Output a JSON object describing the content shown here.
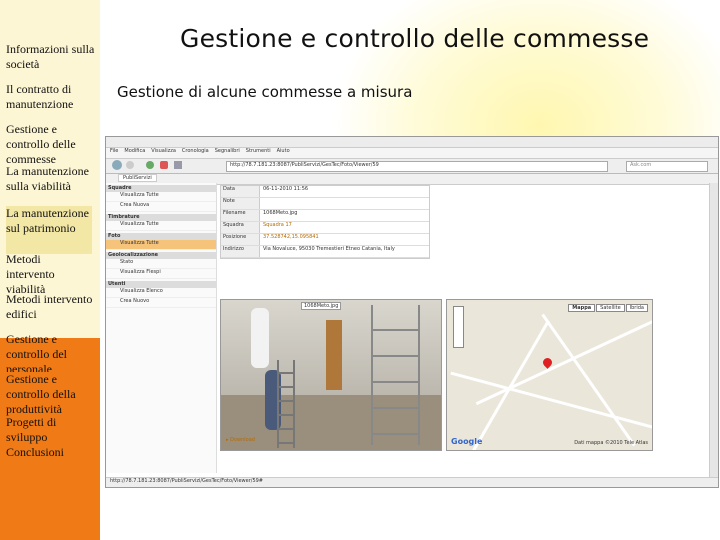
{
  "sidebar": {
    "items": [
      {
        "label": "Informazioni sulla società"
      },
      {
        "label": "Il contratto di manutenzione"
      },
      {
        "label": "Gestione e controllo delle commesse"
      },
      {
        "label": "La manutenzione sulla viabilità"
      },
      {
        "label": "La manutenzione sul patrimonio"
      },
      {
        "label": "Metodi intervento viabilità"
      },
      {
        "label": "Metodi intervento edifici"
      },
      {
        "label": "Gestione e controllo del personale"
      },
      {
        "label": "Gestione e controllo della produttività"
      },
      {
        "label": "Progetti di sviluppo"
      },
      {
        "label": "Conclusioni"
      }
    ]
  },
  "slide": {
    "title": "Gestione e controllo delle commesse",
    "subtitle": "Gestione di alcune commesse a misura"
  },
  "browser": {
    "menu": [
      "File",
      "Modifica",
      "Visualizza",
      "Cronologia",
      "Segnalibri",
      "Strumenti",
      "Aiuto"
    ],
    "address": "http://78.7.181.23:8087/PubliServizi/GesTec/Foto/Viewer/59",
    "search_placeholder": "Ask.com",
    "app_title": "PubliServizi",
    "left_panel": [
      {
        "header": "Squadre",
        "items": [
          "Visualizza Tutte",
          "Crea Nuova"
        ]
      },
      {
        "header": "Timbrature",
        "items": [
          "Visualizza Tutte"
        ]
      },
      {
        "header": "Foto",
        "items": [
          "Visualizza Tutte"
        ]
      },
      {
        "header": "Geolocalizzazione",
        "items": [
          "Stato",
          "Visualizza Flespi"
        ]
      },
      {
        "header": "Utenti",
        "items": [
          "Visualizza Elenco",
          "Crea Nuovo"
        ]
      }
    ],
    "info_rows": [
      {
        "key": "Data",
        "value": "06-11-2010 11:56"
      },
      {
        "key": "Note",
        "value": ""
      },
      {
        "key": "Filename",
        "value": "1068Meto.jpg"
      },
      {
        "key": "Squadra",
        "value": "Squadra 17"
      },
      {
        "key": "Posizione",
        "value": "37.528742,15.095841"
      },
      {
        "key": "Indirizzo",
        "value": "Via Novaluce, 95030 Tremestieri Etneo Catania, Italy"
      }
    ],
    "download_label": "Download",
    "map_tabs": [
      "Mappa",
      "Satellite",
      "Ibrida"
    ],
    "map_credit": "Dati mappa ©2010 Tele Atlas",
    "google_label": "Google",
    "photo_caption": "1068Meto.jpg",
    "status_text": "http://78.7.181.23:8087/PubliServizi/GesTec/Foto/Viewer/59#"
  }
}
